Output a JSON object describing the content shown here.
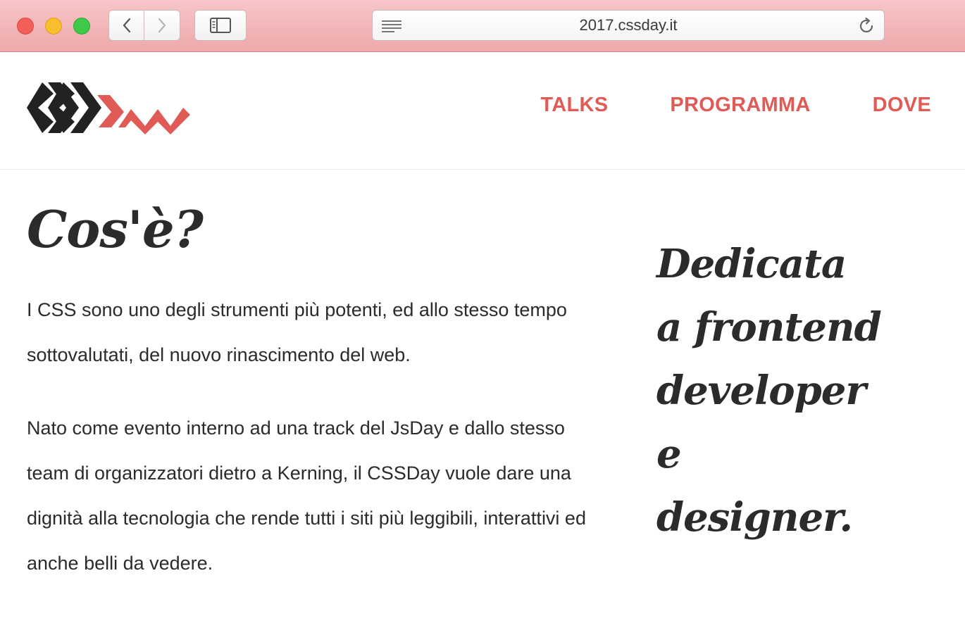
{
  "browser": {
    "url": "2017.cssday.it",
    "colors": {
      "toolbar": "#f2b5b7"
    }
  },
  "header": {
    "logo_icon": "cssday-logo",
    "nav": [
      {
        "label": "TALKS"
      },
      {
        "label": "PROGRAMMA"
      },
      {
        "label": "DOVE"
      }
    ],
    "colors": {
      "accent": "#e05a56",
      "dark": "#2b2b2b"
    }
  },
  "main": {
    "title": "Cos'è?",
    "paragraphs": [
      "I CSS sono uno degli strumenti più potenti, ed allo stesso tempo sottovalutati, del nuovo rinascimento del web.",
      "Nato come evento interno ad una track del JsDay e dallo stesso team di organizzatori dietro a Kerning, il CSSDay vuole dare una dignità alla tecnologia che rende tutti i siti più leggibili, interattivi ed anche belli da vedere."
    ],
    "tagline_lines": [
      "Dedicata",
      "a frontend",
      "developer",
      "e",
      "designer."
    ]
  }
}
